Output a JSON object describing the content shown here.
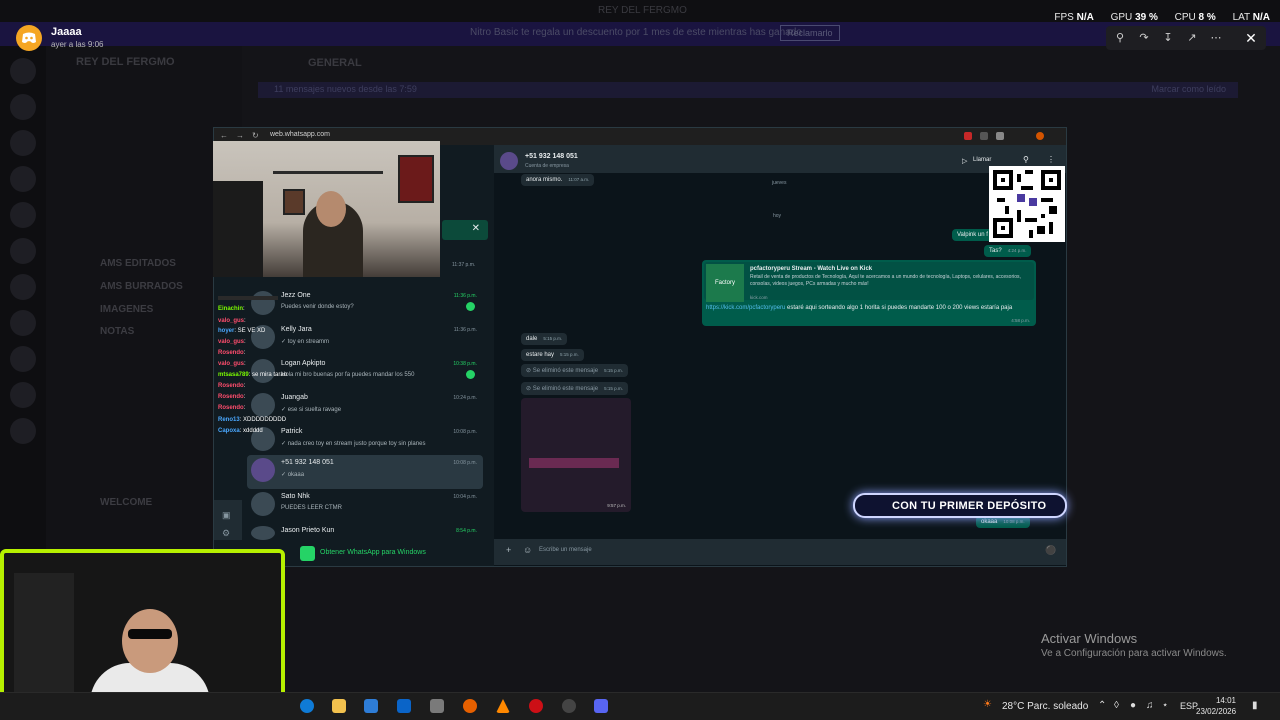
{
  "background": {
    "top_title": "REY DEL FERGMO",
    "banner_text": "Nitro Basic te regala un descuento por 1 mes de este mientras has ganado",
    "banner_button": "Reclamarlo",
    "server_name": "REY DEL FERGMO",
    "channel_general": "GENERAL",
    "unread_text": "11 mensajes nuevos desde las 7:59",
    "unread_right": "Marcar como leído",
    "channels": [
      "AMS EDITADOS",
      "AMS BURRADOS",
      "IMAGENES",
      "NOTAS",
      "WELCOME"
    ]
  },
  "notification": {
    "title": "Jaaaa",
    "time": "ayer a las 9:06"
  },
  "stats": {
    "fps_label": "FPS",
    "fps_value": "N/A",
    "gpu_label": "GPU",
    "gpu_value": "39 %",
    "cpu_label": "CPU",
    "cpu_value": "8 %",
    "lat_label": "LAT",
    "lat_value": "N/A"
  },
  "browser": {
    "url": "web.whatsapp.com"
  },
  "whatsapp": {
    "chats": [
      {
        "name": "Jezz One",
        "msg": "Puedes venir donde estoy?",
        "time": "11:36 p.m.",
        "badge": true
      },
      {
        "name": "Kelly Jara",
        "msg": "✓ toy en streamm",
        "time": "11:36 p.m.",
        "badge": false
      },
      {
        "name": "Logan Apkipto",
        "msg": "Hola mi bro buenas por fa puedes mandar los 550",
        "time": "10:38 p.m.",
        "badge": true
      },
      {
        "name": "Juangab",
        "msg": "✓ ese si suelta ravage",
        "time": "10:24 p.m.",
        "badge": false
      },
      {
        "name": "Patrick",
        "msg": "✓ nada creo toy en stream justo porque toy sin planes",
        "time": "10:08 p.m.",
        "badge": false
      },
      {
        "name": "+51 932 148 051",
        "msg": "✓ okaaa",
        "time": "10:08 p.m.",
        "badge": false
      },
      {
        "name": "Sato Nhk",
        "msg": "PUEDES LEER CTMR",
        "time": "10:04 p.m.",
        "badge": false
      },
      {
        "name": "Jason Prieto Kun",
        "msg": "",
        "time": "8:54 p.m.",
        "badge": false
      }
    ],
    "list_time_top": "11:37 p.m.",
    "get_app": "Obtener WhatsApp para Windows",
    "conversation": {
      "name": "+51 932 148 051",
      "subtitle": "Cuenta de empresa",
      "call_label": "Llamar",
      "day_jueves": "jueves",
      "day_hoy": "hoy",
      "msg1": "anora mismo.",
      "msg1_time": "11:07 a.m.",
      "msg_valpink": "Valpink un f",
      "msg_tas": "Tas?",
      "msg_tas_time": "4:24 p.m.",
      "link_title": "pcfactoryperu Stream - Watch Live on Kick",
      "link_desc": "Retail de venta de productos de Tecnología, Aquí te acercamos a un mundo de tecnología, Laptops, celulares, accesorios, consolas, videos juegos, PCs armadas y mucho más!",
      "link_site": "kick.com",
      "link_logo": "Factory",
      "link_url": "https://kick.com/pcfactoryperu",
      "link_msg": " estaré aqui sorteando algo 1 horita si puedes mandarte 100 o 200 views estaría paja",
      "link_time": "4:58 p.m.",
      "msg_dale": "dale",
      "msg_dale_time": "5:15 p.m.",
      "msg_estare": "estare hay",
      "msg_estare_time": "5:15 p.m.",
      "deleted1": "Se eliminó este mensaje",
      "deleted1_time": "5:15 p.m.",
      "deleted2": "Se eliminó este mensaje",
      "deleted2_time": "5:15 p.m.",
      "img_time": "9:57 p.m.",
      "last_msg": "okaaa",
      "last_time": "10:08 p.m.",
      "composer_placeholder": "Escribe un mensaje"
    }
  },
  "stream_chat": [
    {
      "user": "Einachin",
      "text": ":",
      "color": "#7cfc00"
    },
    {
      "user": "valo_gus",
      "text": ":",
      "color": "#ff4d6d"
    },
    {
      "user": "hoyer",
      "text": ": SE VE XD",
      "color": "#4aa8ff"
    },
    {
      "user": "valo_gus",
      "text": ":",
      "color": "#ff4d6d"
    },
    {
      "user": "Rosendo",
      "text": ":",
      "color": "#ff4d6d"
    },
    {
      "user": "valo_gus",
      "text": ":",
      "color": "#ff4d6d"
    },
    {
      "user": "mtsasa789",
      "text": ": se mira tarao",
      "color": "#7cfc00"
    },
    {
      "user": "Rosendo",
      "text": ":",
      "color": "#ff4d6d"
    },
    {
      "user": "Rosendo",
      "text": ":",
      "color": "#ff4d6d"
    },
    {
      "user": "Rosendo",
      "text": ":",
      "color": "#ff4d6d"
    },
    {
      "user": "Reno13",
      "text": ": XDDDDDDDDD",
      "color": "#4aa8ff"
    },
    {
      "user": "Capoxa",
      "text": ": xddddd",
      "color": "#4aa8ff"
    }
  ],
  "promo": "CON TU PRIMER DEPÓSITO",
  "activate_windows": {
    "title": "Activar Windows",
    "subtitle": "Ve a Configuración para activar Windows."
  },
  "taskbar": {
    "weather": "28°C  Parc. soleado",
    "lang": "ESP",
    "time": "14:01",
    "date": "23/02/2026"
  }
}
